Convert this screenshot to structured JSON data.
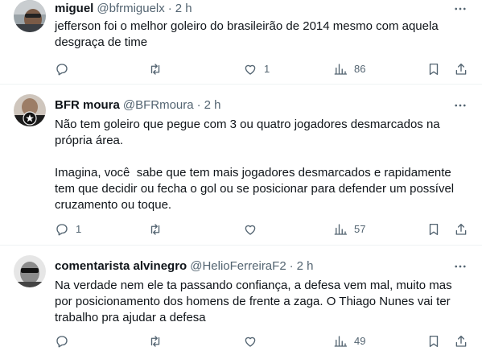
{
  "tweets": [
    {
      "name": "miguel",
      "handle": "@bfrmiguelx",
      "time": "2 h",
      "text": "jefferson foi o melhor goleiro do brasileirão de 2014 mesmo com aquela\ndesgraça de time",
      "replies": "",
      "retweets": "",
      "likes": "1",
      "views": "86"
    },
    {
      "name": "BFR moura",
      "handle": "@BFRmoura",
      "time": "2 h",
      "text": "Não tem goleiro que pegue com 3 ou quatro jogadores desmarcados na\nprópria área.\n\nImagina, você  sabe que tem mais jogadores desmarcados e rapidamente\ntem que decidir ou fecha o gol ou se posicionar para defender um possível\ncruzamento ou toque.",
      "replies": "1",
      "retweets": "",
      "likes": "",
      "views": "57"
    },
    {
      "name": "comentarista alvinegro",
      "handle": "@HelioFerreiraF2",
      "time": "2 h",
      "text": "Na verdade nem ele ta passando confiança, a defesa vem mal, muito mas\npor posicionamento dos homens de frente a zaga. O Thiago Nunes vai ter\ntrabalho pra ajudar a defesa",
      "replies": "",
      "retweets": "",
      "likes": "",
      "views": "49"
    }
  ],
  "separator": "·",
  "icons": {
    "reply": "reply-icon",
    "retweet": "retweet-icon",
    "like": "heart-icon",
    "views": "views-icon",
    "bookmark": "bookmark-icon",
    "share": "share-icon",
    "more": "more-icon"
  },
  "colors": {
    "text": "#0f1419",
    "secondary": "#536471",
    "divider": "#eff3f4"
  }
}
